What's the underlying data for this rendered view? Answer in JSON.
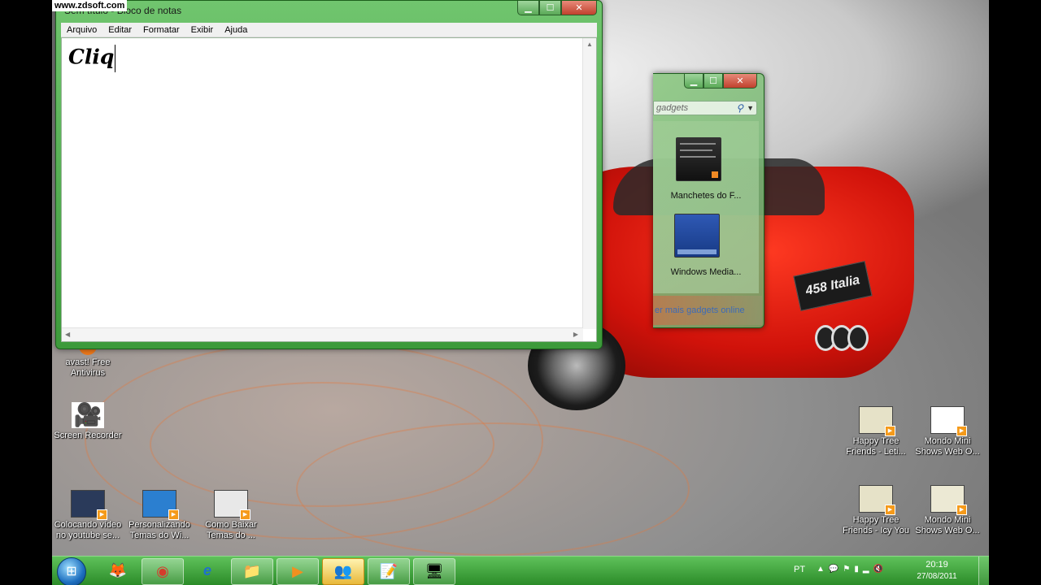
{
  "watermark": "www.zdsoft.com",
  "notepad": {
    "title": "Sem título - Bloco de notas",
    "menu": [
      "Arquivo",
      "Editar",
      "Formatar",
      "Exibir",
      "Ajuda"
    ],
    "content": "Cliq"
  },
  "gadgets": {
    "search_placeholder": "gadgets",
    "items": [
      {
        "label": "Manchetes do F...",
        "icon": "rss-feed-headlines-icon"
      },
      {
        "label": "Windows Media...",
        "icon": "windows-media-center-icon"
      }
    ],
    "online_link": "er mais gadgets online"
  },
  "car": {
    "plate": "458 Italia"
  },
  "desktop_icons": [
    {
      "label": "avast! Free Antivirus",
      "icon": "avast-icon"
    },
    {
      "label": "Screen Recorder",
      "icon": "camera-icon"
    },
    {
      "label": "Colocando vídeo no youtube se...",
      "icon": "video-file-icon"
    },
    {
      "label": "Personalizando Temas do Wi...",
      "icon": "video-file-icon"
    },
    {
      "label": "Como Baixar Temas do ...",
      "icon": "video-file-icon"
    },
    {
      "label": "Happy Tree Friends - Leti...",
      "icon": "video-file-icon"
    },
    {
      "label": "Mondo Mini Shows Web O...",
      "icon": "video-file-icon"
    },
    {
      "label": "Happy Tree Friends - Icy You",
      "icon": "video-file-icon"
    },
    {
      "label": "Mondo Mini Shows Web O...",
      "icon": "video-file-icon"
    }
  ],
  "taskbar": {
    "pinned": [
      {
        "icon": "firefox-icon",
        "glyph": "🦊"
      },
      {
        "icon": "chrome-icon",
        "glyph": "◉"
      },
      {
        "icon": "internet-explorer-icon",
        "glyph": "e"
      },
      {
        "icon": "file-explorer-icon",
        "glyph": "📁"
      },
      {
        "icon": "media-player-icon",
        "glyph": "▶"
      },
      {
        "icon": "windows-live-messenger-icon",
        "glyph": "👥"
      },
      {
        "icon": "notepad-icon",
        "glyph": "📝"
      },
      {
        "icon": "network-monitor-icon",
        "glyph": "🖥"
      }
    ],
    "language": "PT",
    "time": "20:19",
    "date": "27/08/2011"
  }
}
